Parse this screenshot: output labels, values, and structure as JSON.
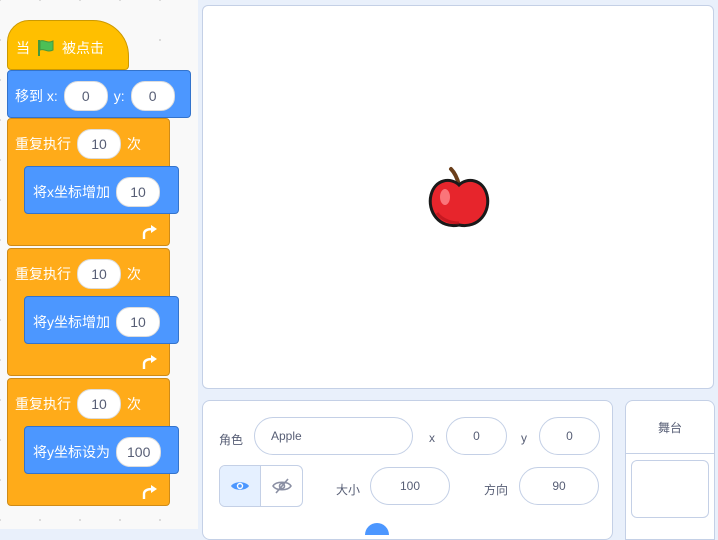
{
  "script": {
    "hat": {
      "when_label": "当",
      "clicked_label": "被点击",
      "flag_icon": "green-flag-icon"
    },
    "goto": {
      "label": "移到 x:",
      "x_value": "0",
      "y_label": "y:",
      "y_value": "0"
    },
    "repeats": [
      {
        "label": "重复执行",
        "times": "10",
        "suffix": "次",
        "inner_label": "将x坐标增加",
        "inner_value": "10"
      },
      {
        "label": "重复执行",
        "times": "10",
        "suffix": "次",
        "inner_label": "将y坐标增加",
        "inner_value": "10"
      },
      {
        "label": "重复执行",
        "times": "10",
        "suffix": "次",
        "inner_label": "将y坐标设为",
        "inner_value": "100"
      }
    ],
    "loop_arrow_icon": "loop-arrow-icon"
  },
  "stage": {
    "sprite_icon": "apple-sprite"
  },
  "sprite_info": {
    "sprite_label": "角色",
    "sprite_name": "Apple",
    "x_label": "x",
    "x_value": "0",
    "y_label": "y",
    "y_value": "0",
    "size_label": "大小",
    "size_value": "100",
    "direction_label": "方向",
    "direction_value": "90",
    "show_icon": "eye-icon",
    "hide_icon": "eye-slash-icon"
  },
  "stage_panel": {
    "title": "舞台"
  },
  "colors": {
    "control": "#ffab19",
    "motion": "#4c97ff",
    "events": "#ffbf00",
    "flag": "#4cbf56",
    "apple": "#e7252c"
  }
}
